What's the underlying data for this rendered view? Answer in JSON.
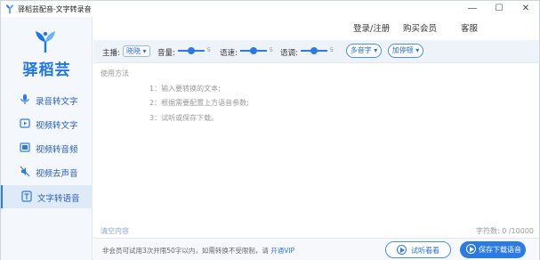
{
  "window": {
    "title": "驿稻芸配音-文字转录音",
    "minimize": "—",
    "maximize": "☐",
    "close": "✕"
  },
  "brand": {
    "name": "驿稻芸",
    "color": "#2176e8"
  },
  "header": {
    "login": "登录/注册",
    "buy_vip": "购买会员",
    "support": "客服"
  },
  "sidebar": {
    "items": [
      {
        "label": "录音转文字",
        "icon": "microphone-icon",
        "active": false
      },
      {
        "label": "视频转文字",
        "icon": "video-icon",
        "active": false
      },
      {
        "label": "视频转音频",
        "icon": "film-icon",
        "active": false
      },
      {
        "label": "视频去声音",
        "icon": "mute-icon",
        "active": false
      },
      {
        "label": "文字转语音",
        "icon": "text-icon",
        "active": true
      }
    ]
  },
  "toolbar": {
    "anchor_label": "主播:",
    "anchor_value": "晓晓 ▾",
    "volume_label": "音量:",
    "volume_value": "5",
    "speed_label": "语速:",
    "speed_value": "5",
    "pitch_label": "语调:",
    "pitch_value": "5",
    "polyphone_button": "多音字 ▾",
    "pause_button": "加停顿 ▾"
  },
  "editor": {
    "usage_title": "使用方法",
    "steps": [
      "1：输入要转换的文本;",
      "2：根据需要配置上方语音参数;",
      "3：试听或保存下载。"
    ],
    "clear_label": "清空内容",
    "char_count": "字符数: 0 /10000"
  },
  "footer": {
    "note": "非会员可试用3次并限50字以内，如需转换不受限制，请 ",
    "vip_link": "开通VIP",
    "preview_button": "试听看看",
    "save_button": "保存下载语音"
  },
  "colors": {
    "accent": "#2c7be5",
    "sidebar_bg": "#f4f7fb",
    "toolbar_bg": "#eef3fa"
  }
}
